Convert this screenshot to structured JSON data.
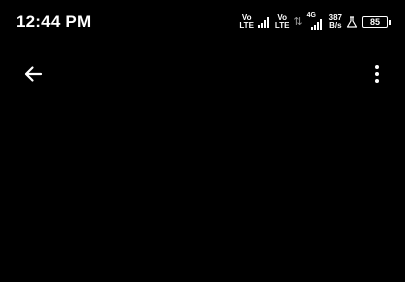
{
  "status_bar": {
    "time": "12:44 PM",
    "sim1": {
      "top": "Vo",
      "bottom": "LTE"
    },
    "sim2": {
      "top": "Vo",
      "bottom": "LTE"
    },
    "network_gen": "4G",
    "speed": {
      "value": "387",
      "unit": "B/s"
    },
    "battery_level": "85",
    "icons": [
      "volte-icon",
      "signal-icon",
      "data-activity-icon",
      "alarm-flask-icon",
      "battery-icon"
    ]
  },
  "app_bar": {
    "back_icon": "arrow-left-icon",
    "menu_icon": "more-vertical-icon"
  },
  "colors": {
    "background": "#000000",
    "foreground": "#ffffff"
  }
}
